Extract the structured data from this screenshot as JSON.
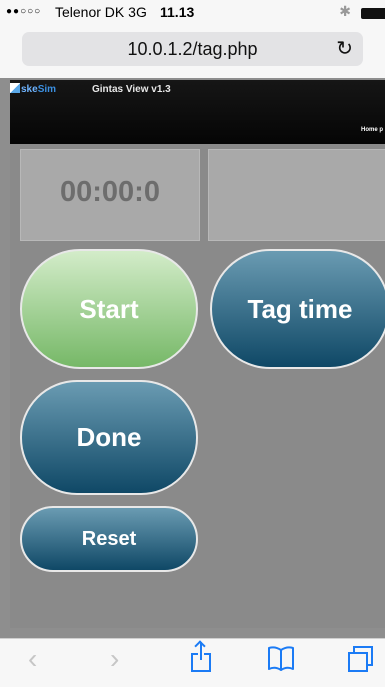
{
  "status_bar": {
    "signal_dots": "●●○○○",
    "carrier": "Telenor DK",
    "network": "3G",
    "time": "11.13"
  },
  "browser": {
    "url": "10.0.1.2/tag.php"
  },
  "page_header": {
    "logo_part_a": "ske",
    "logo_part_b": "Sim",
    "app_title": "Gintas View v1.3",
    "home_link": "Home p"
  },
  "timer": {
    "value": "00:00:0"
  },
  "tag_display": {
    "value": ""
  },
  "buttons": {
    "start": "Start",
    "tag_time": "Tag time",
    "done": "Done",
    "reset": "Reset"
  },
  "toolbar": {
    "back_icon": "chevron-left-icon",
    "forward_icon": "chevron-right-icon",
    "share_icon": "share-icon",
    "bookmarks_icon": "book-icon",
    "tabs_icon": "tabs-icon"
  },
  "colors": {
    "start_top": "#d3ecc9",
    "start_bottom": "#76b867",
    "blue_top": "#6a9bb2",
    "blue_bottom": "#0f4866",
    "ios_blue": "#1b7bf5"
  }
}
